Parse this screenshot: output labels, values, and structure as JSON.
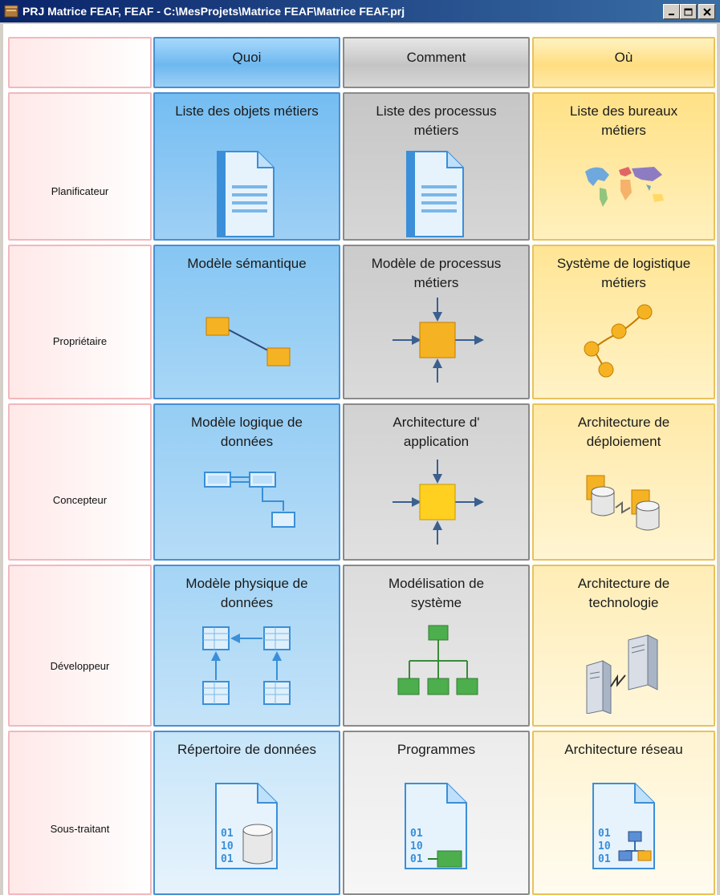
{
  "window": {
    "title": "PRJ Matrice FEAF, FEAF - C:\\MesProjets\\Matrice FEAF\\Matrice FEAF.prj"
  },
  "columns": [
    {
      "label": "Quoi"
    },
    {
      "label": "Comment"
    },
    {
      "label": "Où"
    }
  ],
  "rows": [
    {
      "label": "Planificateur",
      "cells": [
        "Liste des objets métiers",
        "Liste des processus métiers",
        "Liste des bureaux métiers"
      ]
    },
    {
      "label": "Propriétaire",
      "cells": [
        "Modèle sémantique",
        "Modèle de processus métiers",
        "Système de logistique métiers"
      ]
    },
    {
      "label": "Concepteur",
      "cells": [
        "Modèle logique de données",
        "Architecture d' application",
        "Architecture de déploiement"
      ]
    },
    {
      "label": "Développeur",
      "cells": [
        "Modèle physique de données",
        "Modélisation de système",
        "Architecture de technologie"
      ]
    },
    {
      "label": "Sous-traitant",
      "cells": [
        "Répertoire de données",
        "Programmes",
        "Architecture réseau"
      ]
    }
  ],
  "icons": [
    [
      "document-icon",
      "document-icon",
      "world-map-icon"
    ],
    [
      "entity-relation-icon",
      "process-icon",
      "logistics-network-icon"
    ],
    [
      "logical-data-model-icon",
      "application-icon",
      "deployment-icon"
    ],
    [
      "physical-data-model-icon",
      "system-hierarchy-icon",
      "technology-servers-icon"
    ],
    [
      "data-repository-icon",
      "program-icon",
      "network-architecture-icon"
    ]
  ],
  "colors": {
    "what": "#74bdf2",
    "how": "#c6c6c6",
    "where": "#ffe186",
    "row_header_border": "#f2b8bc"
  }
}
